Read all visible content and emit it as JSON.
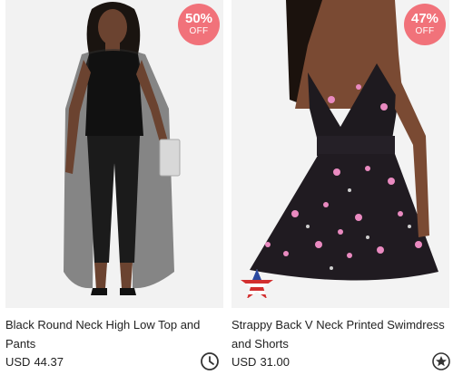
{
  "products": [
    {
      "title": "Black Round Neck High Low Top and Pants",
      "currency": "USD",
      "price": "44.37",
      "discount_pct": "50%",
      "discount_off": "OFF",
      "action_icon": "clock-icon"
    },
    {
      "title": "Strappy Back V Neck Printed Swimdress and Shorts",
      "currency": "USD",
      "price": "31.00",
      "discount_pct": "47%",
      "discount_off": "OFF",
      "action_icon": "star-icon"
    }
  ],
  "colors": {
    "badge": "#f1727a",
    "text": "#222222",
    "background": "#ffffff"
  }
}
